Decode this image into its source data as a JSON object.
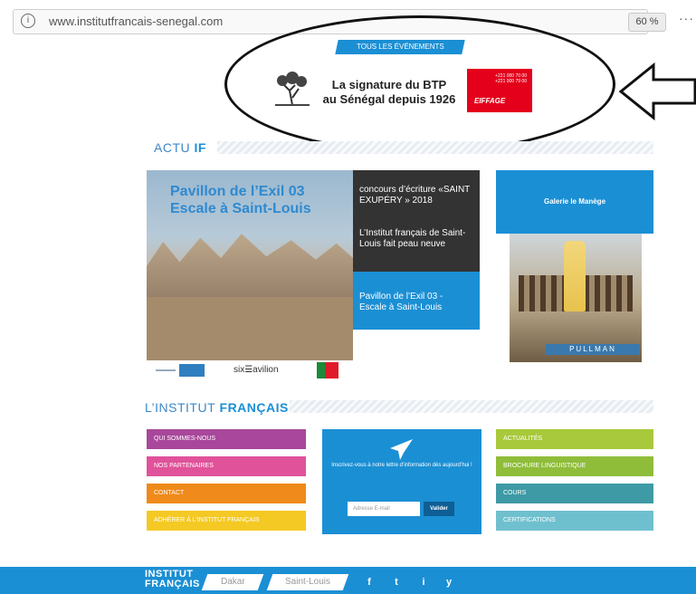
{
  "browser": {
    "url": "www.institutfrancais-senegal.com",
    "zoom": "60 %",
    "more_label": "···",
    "info_icon": "info-icon"
  },
  "header": {
    "events_button": "TOUS LES ÉVÉNEMENTS",
    "ad_line1": "La signature du BTP",
    "ad_line2": "au Sénégal depuis 1926",
    "ad_phone1": "+221 000 70 00",
    "ad_phone2": "+221 000 79 00",
    "ad_brand": "EIFFAGE"
  },
  "actu": {
    "title_first": "ACTU",
    "title_second": "IF",
    "feature_title_line1": "Pavillon de l’Exil 03",
    "feature_title_line2": "Escale à Saint-Louis",
    "list_items": [
      "concours d’écriture «SAINT EXUPÉRY » 2018",
      "L’Institut français de Saint-Louis fait peau neuve",
      "Pavillon de l’Exil 03 - Escale à Saint-Louis"
    ],
    "gallery_label": "Galerie le Manège",
    "photo_sign": "PULLMAN",
    "partner_logo": "six☰avilion"
  },
  "institut": {
    "title_first": "L’INSTITUT",
    "title_second": "FRANÇAIS",
    "left_buttons": [
      {
        "label": "QUI SOMMES-NOUS",
        "color": "#a8479b"
      },
      {
        "label": "NOS PARTENAIRES",
        "color": "#e0529a"
      },
      {
        "label": "CONTACT",
        "color": "#f08a1a"
      },
      {
        "label": "ADHÉRER À L’INSTITUT FRANÇAIS",
        "color": "#f4c923"
      }
    ],
    "right_buttons": [
      {
        "label": "ACTUALITÉS",
        "color": "#a8c93b"
      },
      {
        "label": "BROCHURE LINGUISTIQUE",
        "color": "#8fbd3a"
      },
      {
        "label": "COURS",
        "color": "#3e9aa4"
      },
      {
        "label": "CERTIFICATIONS",
        "color": "#6fc0cf"
      }
    ],
    "newsletter_text": "Inscrivez-vous à notre lettre d’information dès aujourd’hui !",
    "email_placeholder": "Adresse E-mail",
    "submit_label": "Valider"
  },
  "footer": {
    "brand_line1": "INSTITUT",
    "brand_line2": "FRANÇAIS",
    "city1": "Dakar",
    "city2": "Saint-Louis",
    "social": [
      "f",
      "t",
      "i",
      "y"
    ]
  },
  "colors": {
    "brand_blue": "#1b8fd4",
    "annotation": "#111111"
  }
}
